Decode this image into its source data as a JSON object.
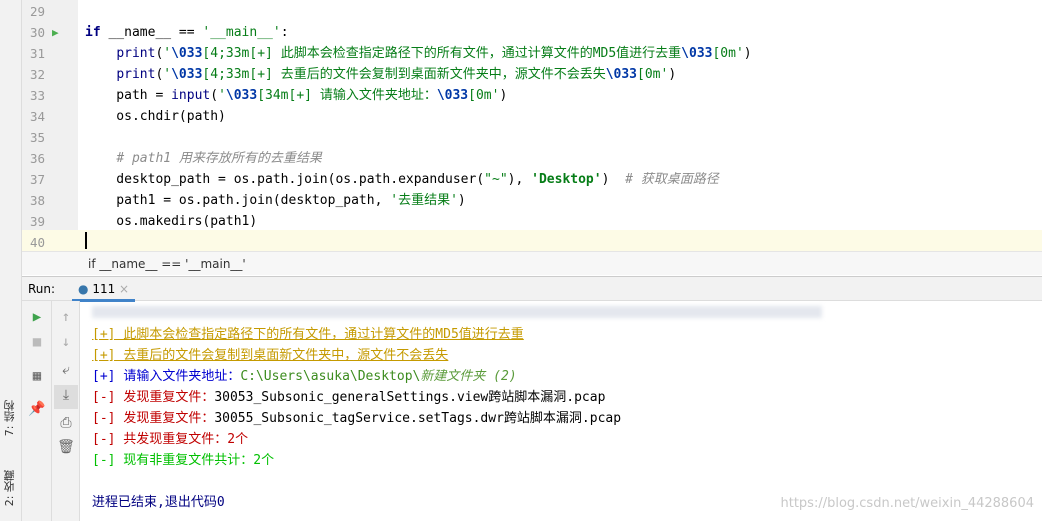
{
  "editor": {
    "lines": [
      {
        "n": "29",
        "segs": []
      },
      {
        "n": "30",
        "segs": [
          [
            "if ",
            "kw"
          ],
          [
            "__name__ == ",
            ""
          ],
          [
            "'__main__'",
            "str"
          ],
          [
            ":",
            ""
          ]
        ]
      },
      {
        "n": "31",
        "segs": [
          [
            "    ",
            ""
          ],
          [
            "print",
            "fn"
          ],
          [
            "(",
            ""
          ],
          [
            "'",
            "str"
          ],
          [
            "\\033",
            "esc"
          ],
          [
            "[4;33m[+] 此脚本会检查指定路径下的所有文件，通过计算文件的MD5值进行去重",
            "str"
          ],
          [
            "\\033",
            "esc"
          ],
          [
            "[0m'",
            "str"
          ],
          [
            ")",
            ""
          ]
        ]
      },
      {
        "n": "32",
        "segs": [
          [
            "    ",
            ""
          ],
          [
            "print",
            "fn"
          ],
          [
            "(",
            ""
          ],
          [
            "'",
            "str"
          ],
          [
            "\\033",
            "esc"
          ],
          [
            "[4;33m[+] 去重后的文件会复制到桌面新文件夹中，源文件不会丢失",
            "str"
          ],
          [
            "\\033",
            "esc"
          ],
          [
            "[0m'",
            "str"
          ],
          [
            ")",
            ""
          ]
        ]
      },
      {
        "n": "33",
        "segs": [
          [
            "    path = ",
            ""
          ],
          [
            "input",
            "fn"
          ],
          [
            "(",
            ""
          ],
          [
            "'",
            "str"
          ],
          [
            "\\033",
            "esc"
          ],
          [
            "[34m[+] 请输入文件夹地址：",
            "str"
          ],
          [
            "\\033",
            "esc"
          ],
          [
            "[0m'",
            "str"
          ],
          [
            ")",
            ""
          ]
        ]
      },
      {
        "n": "34",
        "segs": [
          [
            "    os.chdir(path)",
            ""
          ]
        ]
      },
      {
        "n": "35",
        "segs": []
      },
      {
        "n": "36",
        "segs": [
          [
            "    ",
            ""
          ],
          [
            "# path1 用来存放所有的去重结果",
            "cm"
          ]
        ]
      },
      {
        "n": "37",
        "segs": [
          [
            "    desktop_path = os.path.join(os.path.expanduser(",
            ""
          ],
          [
            "\"~\"",
            "str"
          ],
          [
            "), ",
            ""
          ],
          [
            "'Desktop'",
            "strb"
          ],
          [
            ")  ",
            ""
          ],
          [
            "# 获取桌面路径",
            "cm"
          ]
        ]
      },
      {
        "n": "38",
        "segs": [
          [
            "    path1 = os.path.join(desktop_path, ",
            ""
          ],
          [
            "'去重结果'",
            "str"
          ],
          [
            ")",
            ""
          ]
        ]
      },
      {
        "n": "39",
        "segs": [
          [
            "    os.makedirs(path1)",
            ""
          ]
        ]
      },
      {
        "n": "40",
        "segs": []
      }
    ],
    "breadcrumb": "if __name__ == '__main__'"
  },
  "run": {
    "label": "Run:",
    "tab": "111",
    "close": "×",
    "output": [
      [
        [
          "[+] 此脚本会检查指定路径下的所有文件，通过计算文件的MD5值进行去重",
          "y"
        ]
      ],
      [
        [
          "[+] 去重后的文件会复制到桌面新文件夹中，源文件不会丢失",
          "y"
        ]
      ],
      [
        [
          "[+] ",
          "b"
        ],
        [
          "请输入文件夹地址：",
          "b"
        ],
        [
          "C:\\Users\\asuka\\Desktop\\",
          "gr"
        ],
        [
          "新建文件夹 (2)",
          "gi"
        ]
      ],
      [
        [
          "[-] ",
          "r"
        ],
        [
          "发现重复文件：",
          "r"
        ],
        [
          "30053_Subsonic_generalSettings.view跨站脚本漏洞.pcap",
          "k"
        ]
      ],
      [
        [
          "[-] ",
          "r"
        ],
        [
          "发现重复文件：",
          "r"
        ],
        [
          "30055_Subsonic_tagService.setTags.dwr跨站脚本漏洞.pcap",
          "k"
        ]
      ],
      [
        [
          "[-] 共发现重复文件：2个",
          "r"
        ]
      ],
      [
        [
          "[-] 现有非重复文件共计：2个",
          "g"
        ]
      ],
      [],
      [
        [
          "进程已结束,退出代码0",
          "nv"
        ]
      ]
    ]
  },
  "side": {
    "structure": "7: 结构",
    "favorites": "2: 收藏"
  },
  "watermark": "https://blog.csdn.net/weixin_44288604"
}
